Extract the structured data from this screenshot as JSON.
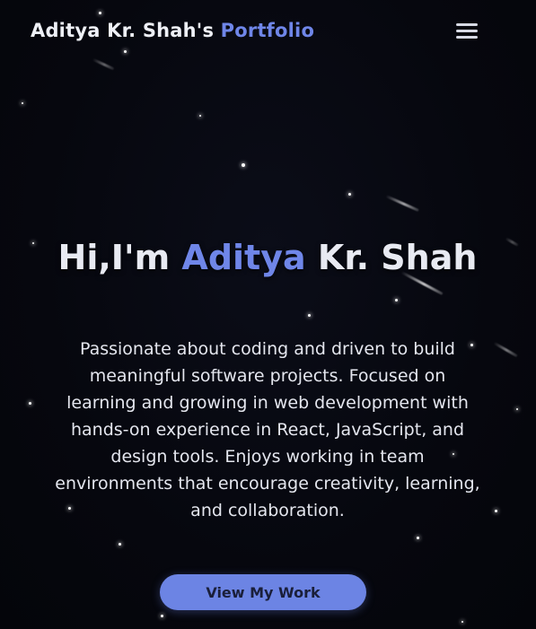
{
  "nav": {
    "brand_name": "Aditya Kr. Shah's",
    "brand_accent": "Portfolio",
    "menu_icon": "hamburger-menu-icon"
  },
  "hero": {
    "greeting": "Hi,I'm",
    "first_name": "Aditya",
    "last_name": "Kr. Shah",
    "description": "Passionate about coding and driven to build meaningful software projects. Focused on learning and growing in web development with hands-on experience in React, JavaScript, and design tools. Enjoys working in team environments that encourage creativity, learning, and collaboration.",
    "cta_label": "View My Work"
  },
  "colors": {
    "background": "#05060d",
    "accent": "#6f86e8",
    "button": "#6c84e4",
    "text": "#e8eaf2"
  }
}
